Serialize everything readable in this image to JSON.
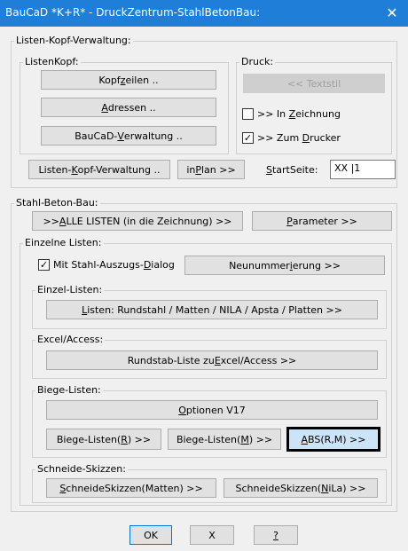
{
  "window": {
    "title": "BauCaD *K+R* - DruckZentrum-StahlBetonBau:",
    "close_glyph": "✕"
  },
  "listen_kopf": {
    "group_label": "Listen-Kopf-Verwaltung:",
    "listenkopf_label": "ListenKopf:",
    "kopfzeilen": [
      "Kopf",
      "z",
      "eilen .."
    ],
    "adressen": [
      "",
      "A",
      "dressen .."
    ],
    "baucad": [
      "BauCaD-",
      "V",
      "erwaltung .."
    ],
    "druck_label": "Druck:",
    "textstil": "<< Textstil",
    "in_zeichnung": {
      "checked": false,
      "parts": [
        ">> In ",
        "Z",
        "eichnung"
      ]
    },
    "zum_drucker": {
      "checked": true,
      "parts": [
        ">> Zum ",
        "D",
        "rucker"
      ]
    },
    "lkv_button": [
      "Listen-",
      "K",
      "opf-Verwaltung .."
    ],
    "in_plan": [
      "in ",
      "P",
      "lan >>"
    ],
    "startseite": [
      "",
      "S",
      "tartSeite:"
    ],
    "startseite_value": "XX |1"
  },
  "stahl": {
    "group_label": "Stahl-Beton-Bau:",
    "alle_listen": [
      ">> ",
      "A",
      "LLE LISTEN (in die Zeichnung) >>"
    ],
    "parameter": [
      "",
      "P",
      "arameter >>"
    ],
    "einzelne_label": "Einzelne Listen:",
    "mit_stahl": {
      "checked": true,
      "parts": [
        "Mit Stahl-Auszugs-",
        "D",
        "ialog"
      ]
    },
    "neunummerierung": [
      "Neunummer",
      "i",
      "erung >>"
    ],
    "einzel_label": "Einzel-Listen:",
    "listen_rundstahl": [
      "",
      "L",
      "isten: Rundstahl / Matten / NILA / Apsta / Platten >>"
    ],
    "excel_label": "Excel/Access:",
    "rundstab": [
      "Rundstab-Liste zu ",
      "E",
      "xcel/Access >>"
    ],
    "biege_label": "Biege-Listen:",
    "optionen": [
      "",
      "O",
      "ptionen V17"
    ],
    "biege_r": [
      "Biege-Listen(",
      "R",
      ") >>"
    ],
    "biege_m": [
      "Biege-Listen(",
      "M",
      ") >>"
    ],
    "abs": [
      "",
      "A",
      "BS(R,M) >>"
    ],
    "schneide_label": "Schneide-Skizzen:",
    "schneide_matten": [
      "",
      "S",
      "chneideSkizzen(Matten) >>"
    ],
    "schneide_nila": [
      "SchneideSkizzen(",
      "N",
      "iLa) >>"
    ]
  },
  "footer": {
    "ok": "OK",
    "x": "X",
    "help": "?"
  },
  "colors": {
    "titlebar": "#1f7fd8",
    "dialog_bg": "#f0f0f0",
    "focus_button": "#cce4f7"
  }
}
